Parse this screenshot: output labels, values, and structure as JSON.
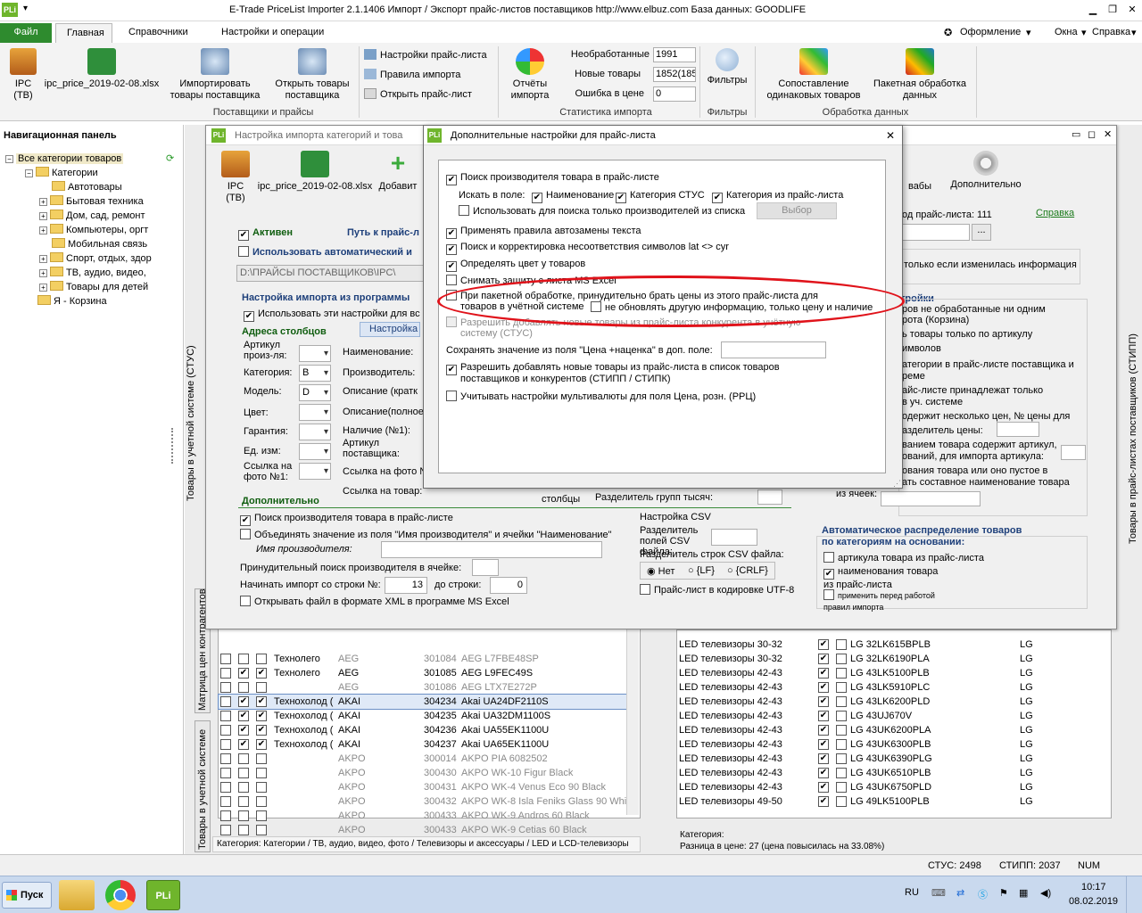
{
  "window": {
    "title": "E-Trade PriceList Importer 2.1.1406     Импорт / Экспорт прайс-листов поставщиков     http://www.elbuz.com     База данных: GOODLIFE",
    "app_icon": "PLi",
    "quick_access": "▾"
  },
  "tabs": {
    "file": "Файл",
    "main": "Главная",
    "dictionaries": "Справочники",
    "settings": "Настройки и операции",
    "design": "Оформление",
    "windows": "Окна",
    "help": "Справка"
  },
  "ribbon": {
    "ipc_label": "IPC",
    "ipc_sub": "(ТВ)",
    "file_label": "ipc_price_2019-02-08.xlsx",
    "import_label": "Импортировать товары поставщика",
    "open_label": "Открыть товары поставщика",
    "group1": "Поставщики и прайсы",
    "pricelist_settings": "Настройки прайс-листа",
    "import_rules": "Правила импорта",
    "open_pricelist": "Открыть прайс-лист",
    "reports_label": "Отчёты импорта",
    "stat_unprocessed_lbl": "Необработанные",
    "stat_unprocessed_val": "1991",
    "stat_new_lbl": "Новые товары",
    "stat_new_val": "1852(185",
    "stat_error_lbl": "Ошибка в цене",
    "stat_error_val": "0",
    "group2": "Статистика импорта",
    "filters_label": "Фильтры",
    "group3": "Фильтры",
    "compare_label": "Сопоставление одинаковых товаров",
    "batch_label": "Пакетная обработка данных",
    "group4": "Обработка данных"
  },
  "nav": {
    "title": "Навигационная панель",
    "root": "Все категории товаров",
    "categories": "Категории",
    "items": [
      "Автотовары",
      "Бытовая техника",
      "Дом, сад, ремонт",
      "Компьютеры, оргт",
      "Мобильная связь",
      "Спорт, отдых, здор",
      "ТВ, аудио, видео,",
      "Товары для детей"
    ],
    "basket": "Я - Корзина"
  },
  "import_window": {
    "title": "Настройка импорта категорий и това",
    "ipc": "IPC",
    "ipc_sub": "(ТВ)",
    "file": "ipc_price_2019-02-08.xlsx",
    "add": "Добавит",
    "extra_label": "Дополнительно",
    "vabl": "вабы",
    "active": "Активен",
    "path_lbl": "Путь к прайс-л",
    "auto_use": "Использовать автоматический и",
    "path_val": "D:\\ПРАЙСЫ ПОСТАВЩИКОВ\\IPC\\",
    "import_from": "Настройка импорта из программы",
    "use_these": "Использовать эти настройки для вс",
    "addr_columns": "Адреса столбцов",
    "settings_btn": "Настройка",
    "article_lbl": "Артикул произ-ля:",
    "category_lbl": "Категория:",
    "category_val": "B",
    "model_lbl": "Модель:",
    "model_val": "D",
    "color_lbl": "Цвет:",
    "warranty_lbl": "Гарантия:",
    "unit_lbl": "Ед. изм:",
    "photo_lbl": "Ссылка на фото №1:",
    "name_lbl": "Наименование:",
    "maker_lbl": "Производитель:",
    "desc_short": "Описание (кратк",
    "desc_full": "Описание(полное",
    "avail_lbl": "Наличие (№1):",
    "supp_art": "Артикул поставщика:",
    "photo_link": "Ссылка на фото №",
    "photo_link2": "Ссылка на товар:",
    "columns": "столбцы",
    "extra_section": "Дополнительно",
    "search_maker": "Поиск производителя товара в прайс-листе",
    "merge_field": "Объединять значение из поля \"Имя производителя\" и ячейки \"Наименование\"",
    "maker_name": "Имя производителя:",
    "force_search": "Принудительный поиск производителя в ячейке:",
    "start_row_lbl": "Начинать импорт со строки №:",
    "start_row_val": "13",
    "to_row_lbl": "до строки:",
    "to_row_val": "0",
    "open_xml": "Открывать файл в формате XML в программе MS Excel",
    "thousand_sep": "Разделитель групп тысяч:",
    "csv_title": "Настройка CSV",
    "csv_field_sep": "Разделитель полей CSV файла:",
    "csv_row_sep": "Разделитель строк CSV файла:",
    "csv_none": "Нет",
    "csv_lf": "{LF}",
    "csv_crlf": "{CRLF}",
    "utf8": "Прайс-лист в кодировке UTF-8",
    "right_id": "од прайс-листа: 111",
    "right_help": "Справка",
    "right_only_changed": "только если изменилась информация",
    "right_title": "тройки",
    "right_r1": "ров не обработанные ни одним",
    "right_r2": "рота (Корзина)",
    "right_r3": "ь товары только по артикулу",
    "right_r4": "имволов",
    "right_r5": "атегории в прайс-листе поставщика и",
    "right_r6": "реме",
    "right_r7": "айс-листе принадлежат только",
    "right_r8": "в уч. системе",
    "right_r9": "одержит несколько цен, № цены для",
    "right_r10": "азделитель цены:",
    "right_r11": "ванием товара содержит артикул,",
    "right_r12": "ований, для импорта артикула:",
    "right_r13": "ования товара или оно пустое в",
    "right_r14": "ать составное наименование товара",
    "right_r15": "из ячеек:",
    "auto_dist": "Автоматическое распределение товаров по категориям на основании:",
    "by_article": "артикула товара из прайс-листа",
    "by_name": "наименования товара из прайс-листа",
    "apply_rules": "применить перед работой правил импорта"
  },
  "dialog": {
    "title": "Дополнительные настройки для прайс-листа",
    "opt_search_maker": "Поиск производителя товара в прайс-листе",
    "search_in": "Искать в поле:",
    "f_name": "Наименование",
    "f_cat_stus": "Категория СТУС",
    "f_cat_price": "Категория из прайс-листа",
    "use_only_list": "Использовать для поиска только производителей из списка",
    "choose_btn": "Выбор",
    "autoreplace": "Применять правила автозамены текста",
    "lat_cyr": "Поиск и корректировка несоответствия символов lat <> cyr",
    "detect_color": "Определять цвет у товаров",
    "remove_protect": "Снимать защиту с листа MS Excel",
    "force_price_1": "При пакетной обработке, принудительно брать цены из этого прайс-листа для",
    "force_price_2": "товаров в учётной системе",
    "no_update_other": "не обновлять другую информацию, только цену и наличие",
    "allow_competitor_1": "Разрешить добавлять новые товары из прайс-листа конкурента в учётную",
    "allow_competitor_2": "систему (СТУС)",
    "save_value": "Сохранять значение из поля \"Цена +наценка\" в доп. поле:",
    "allow_add_1": "Разрешить добавлять новые товары из прайс-листа в список товаров",
    "allow_add_2": "поставщиков и конкурентов (СТИПП / СТИПК)",
    "multicurrency": "Учитывать настройки мультивалюты для поля Цена, розн. (РРЦ)"
  },
  "left_grid": {
    "rows": [
      {
        "c1": "",
        "c2": "Технолего",
        "c3": "AEG",
        "code": "301084",
        "name": "AEG L7FBE48SP",
        "chk": false,
        "grey": true
      },
      {
        "c1": "",
        "c2": "Технолего",
        "c3": "AEG",
        "code": "301085",
        "name": "AEG L9FEC49S",
        "chk": true,
        "grey": false
      },
      {
        "c1": "",
        "c2": "",
        "c3": "AEG",
        "code": "301086",
        "name": "AEG LTX7E272P",
        "chk": false,
        "grey": true
      },
      {
        "c1": "",
        "c2": "Технохолод (",
        "c3": "AKAI",
        "code": "304234",
        "name": "Akai UA24DF2110S",
        "chk": true,
        "grey": false
      },
      {
        "c1": "",
        "c2": "Технохолод (",
        "c3": "AKAI",
        "code": "304235",
        "name": "Akai UA32DM1100S",
        "chk": true,
        "grey": false
      },
      {
        "c1": "",
        "c2": "Технохолод (",
        "c3": "AKAI",
        "code": "304236",
        "name": "Akai UA55EK1100U",
        "chk": true,
        "grey": false
      },
      {
        "c1": "",
        "c2": "Технохолод (",
        "c3": "AKAI",
        "code": "304237",
        "name": "Akai UA65EK1100U",
        "chk": true,
        "grey": false
      },
      {
        "c1": "",
        "c2": "",
        "c3": "AKPO",
        "code": "300014",
        "name": "AKPO PIA 6082502",
        "chk": false,
        "grey": true
      },
      {
        "c1": "",
        "c2": "",
        "c3": "AKPO",
        "code": "300430",
        "name": "AKPO WK-10 Figur Black",
        "chk": false,
        "grey": true
      },
      {
        "c1": "",
        "c2": "",
        "c3": "AKPO",
        "code": "300431",
        "name": "AKPO WK-4 Venus Eco 90 Black",
        "chk": false,
        "grey": true
      },
      {
        "c1": "",
        "c2": "",
        "c3": "AKPO",
        "code": "300432",
        "name": "AKPO WK-8 Isla Feniks Glass 90 White",
        "chk": false,
        "grey": true
      },
      {
        "c1": "",
        "c2": "",
        "c3": "AKPO",
        "code": "300433",
        "name": "AKPO WK-9 Andros 60 Black",
        "chk": false,
        "grey": true
      },
      {
        "c1": "",
        "c2": "",
        "c3": "AKPO",
        "code": "300433",
        "name": "AKPO WK-9 Cetias 60 Black",
        "chk": false,
        "grey": true
      }
    ],
    "category_path": "Категория: Категории / ТВ, аудио, видео, фото / Телевизоры и аксессуары / LED и LCD-телевизоры"
  },
  "right_grid": {
    "rows": [
      {
        "cat": "LED телевизоры 30-32",
        "name": "LG 32LK615BPLB",
        "brand": "LG"
      },
      {
        "cat": "LED телевизоры 30-32",
        "name": "LG 32LK6190PLA",
        "brand": "LG"
      },
      {
        "cat": "LED телевизоры 42-43",
        "name": "LG 43LK5100PLB",
        "brand": "LG"
      },
      {
        "cat": "LED телевизоры 42-43",
        "name": "LG 43LK5910PLC",
        "brand": "LG"
      },
      {
        "cat": "LED телевизоры 42-43",
        "name": "LG 43LK6200PLD",
        "brand": "LG"
      },
      {
        "cat": "LED телевизоры 42-43",
        "name": "LG 43UJ670V",
        "brand": "LG"
      },
      {
        "cat": "LED телевизоры 42-43",
        "name": "LG 43UK6200PLA",
        "brand": "LG"
      },
      {
        "cat": "LED телевизоры 42-43",
        "name": "LG 43UK6300PLB",
        "brand": "LG"
      },
      {
        "cat": "LED телевизоры 42-43",
        "name": "LG 43UK6390PLG",
        "brand": "LG"
      },
      {
        "cat": "LED телевизоры 42-43",
        "name": "LG 43UK6510PLB",
        "brand": "LG"
      },
      {
        "cat": "LED телевизоры 42-43",
        "name": "LG 43UK6750PLD",
        "brand": "LG"
      },
      {
        "cat": "LED телевизоры 49-50",
        "name": "LG 49LK5100PLB",
        "brand": "LG"
      }
    ],
    "footer_cat": "Категория:",
    "footer_diff": "Разница в цене: 27  (цена повысилась на 33.08%)"
  },
  "side_tabs": {
    "matrix": "Матрица цен контрагентов",
    "products": "Товары в учетной системе",
    "left_vertical": "Товары в учетной системе (СТУС)",
    "right_vertical": "Товары в прайс-листах поставщиков (СТИПП)"
  },
  "status": {
    "stus": "СТУС: 2498",
    "stipp": "СТИПП: 2037",
    "num": "NUM"
  },
  "taskbar": {
    "start": "Пуск",
    "lang": "RU",
    "time": "10:17",
    "date": "08.02.2019"
  },
  "colors": {
    "accent_green": "#2e8b2e",
    "section_green": "#0f5d0f",
    "highlight_red": "#e0121a"
  }
}
